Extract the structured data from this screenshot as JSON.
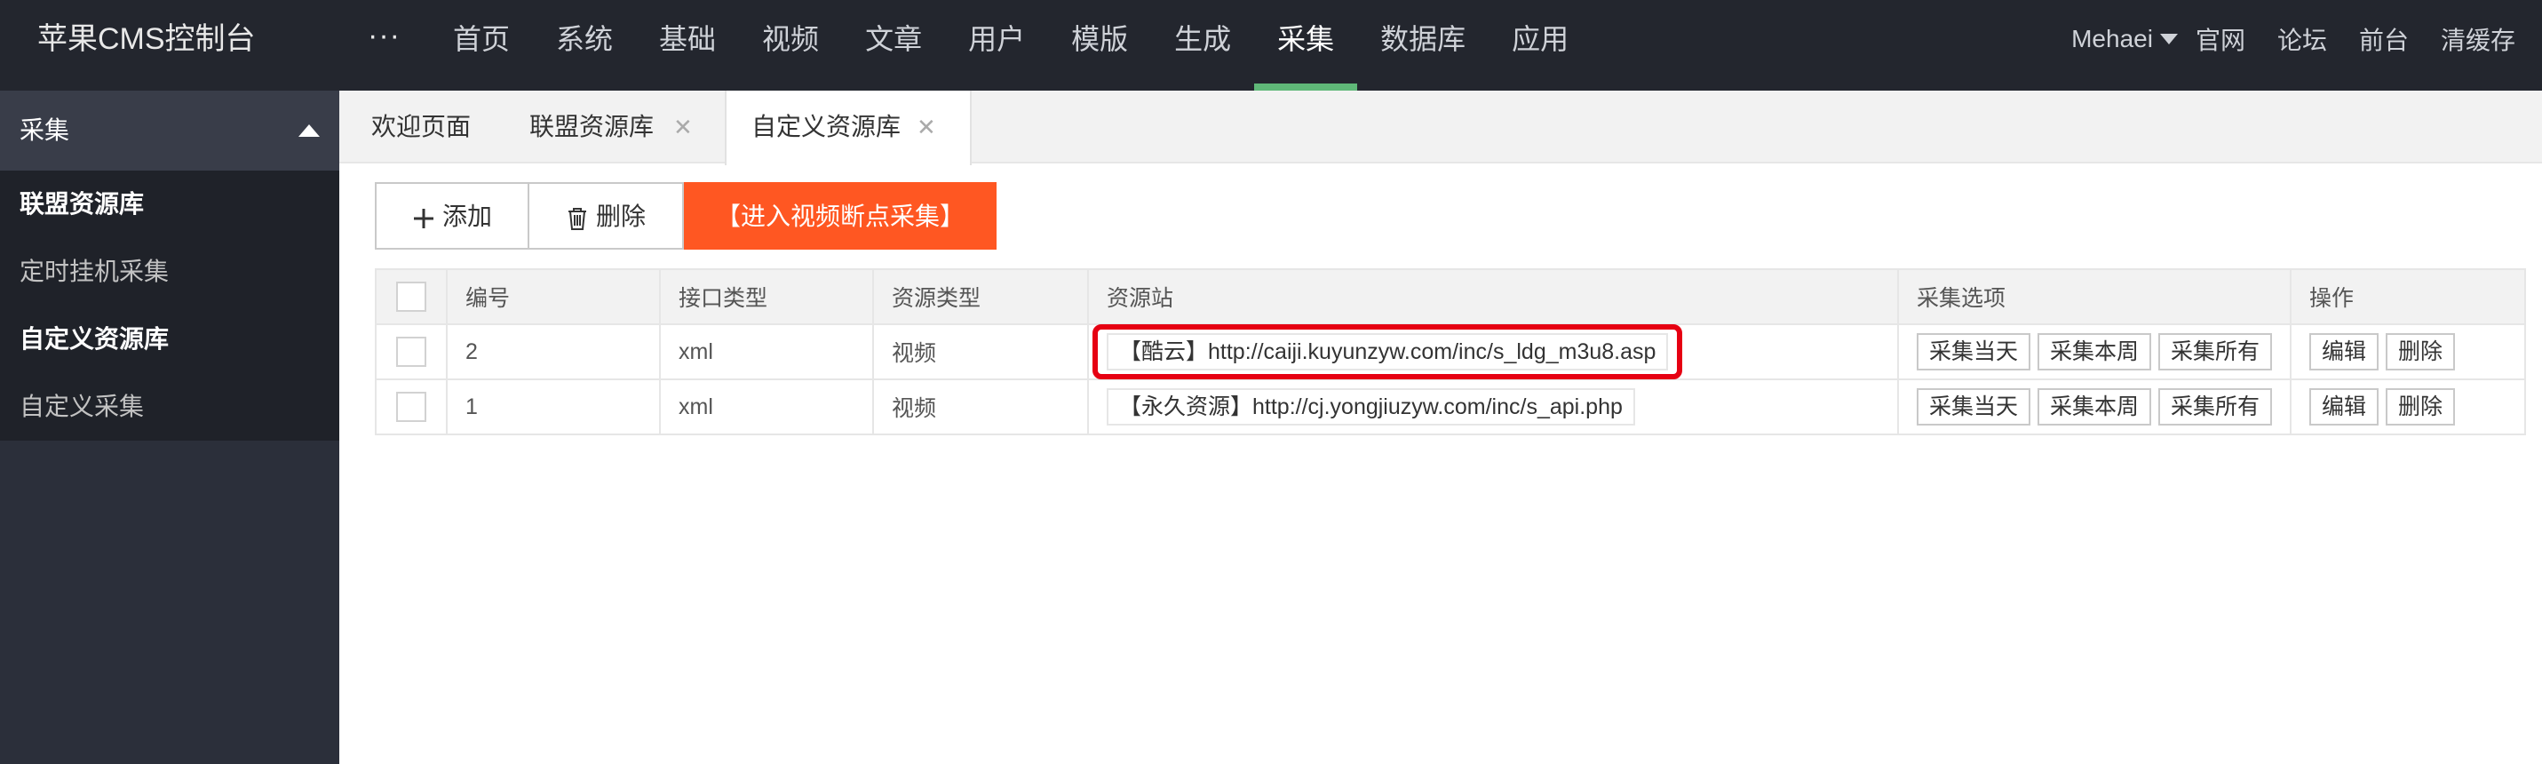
{
  "header": {
    "logo": "苹果CMS控制台",
    "more": "···",
    "nav": [
      "首页",
      "系统",
      "基础",
      "视频",
      "文章",
      "用户",
      "模版",
      "生成",
      "采集",
      "数据库",
      "应用"
    ],
    "active_nav": "采集",
    "user": "Mehaei",
    "links": [
      "官网",
      "论坛",
      "前台",
      "清缓存"
    ]
  },
  "sidebar": {
    "title": "采集",
    "items": [
      {
        "label": "联盟资源库",
        "bold": true
      },
      {
        "label": "定时挂机采集",
        "bold": false
      },
      {
        "label": "自定义资源库",
        "bold": true
      },
      {
        "label": "自定义采集",
        "bold": false
      }
    ]
  },
  "tabs": [
    {
      "label": "欢迎页面",
      "closable": false
    },
    {
      "label": "联盟资源库",
      "closable": true
    },
    {
      "label": "自定义资源库",
      "closable": true,
      "active": true
    }
  ],
  "toolbar": {
    "add": "添加",
    "delete": "删除",
    "enter": "【进入视频断点采集】"
  },
  "table": {
    "headers": [
      "编号",
      "接口类型",
      "资源类型",
      "资源站",
      "采集选项",
      "操作"
    ],
    "rows": [
      {
        "id": "2",
        "api": "xml",
        "type": "视频",
        "site": "【酷云】http://caiji.kuyunzyw.com/inc/s_ldg_m3u8.asp",
        "highlighted": true
      },
      {
        "id": "1",
        "api": "xml",
        "type": "视频",
        "site": "【永久资源】http://cj.yongjiuzyw.com/inc/s_api.php",
        "highlighted": false
      }
    ],
    "collect_options": [
      "采集当天",
      "采集本周",
      "采集所有"
    ],
    "actions": [
      "编辑",
      "删除"
    ]
  },
  "colors": {
    "accent_green": "#5fb878",
    "orange": "#ff5722",
    "highlight_red": "#e60012",
    "header_bg": "#23262e"
  }
}
